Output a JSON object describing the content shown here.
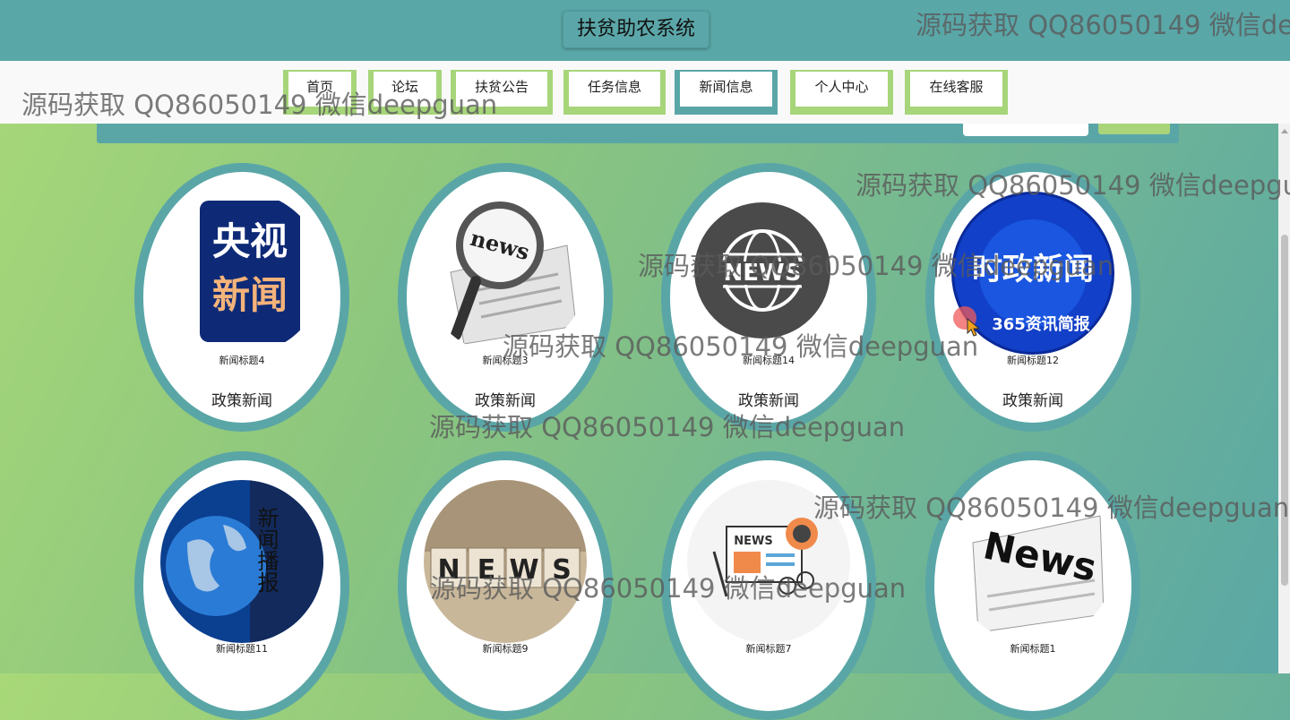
{
  "header": {
    "title": "扶贫助农系统"
  },
  "nav": {
    "items": [
      {
        "label": "首页"
      },
      {
        "label": "论坛"
      },
      {
        "label": "扶贫公告"
      },
      {
        "label": "任务信息"
      },
      {
        "label": "新闻信息"
      },
      {
        "label": "个人中心"
      },
      {
        "label": "在线客服"
      }
    ],
    "active": "新闻信息"
  },
  "news": [
    {
      "title": "新闻标题4",
      "category": "政策新闻",
      "image": "cctv-news-logo"
    },
    {
      "title": "新闻标题3",
      "category": "政策新闻",
      "image": "newspaper-magnifier"
    },
    {
      "title": "新闻标题14",
      "category": "政策新闻",
      "image": "news-globe-icon"
    },
    {
      "title": "新闻标题12",
      "category": "政策新闻",
      "image": "current-affairs-news"
    },
    {
      "title": "新闻标题11",
      "category": "",
      "image": "news-broadcast-globe"
    },
    {
      "title": "新闻标题9",
      "category": "",
      "image": "news-blocks"
    },
    {
      "title": "新闻标题7",
      "category": "",
      "image": "news-flat-illustration"
    },
    {
      "title": "新闻标题1",
      "category": "",
      "image": "newspaper-news"
    }
  ],
  "thumb_text": {
    "cctv_line1": "央视",
    "cctv_line2": "新闻",
    "mag_news": "news",
    "globe_news": "NEWS",
    "shizheng": "时政新闻",
    "shizheng_sub": "365资讯简报",
    "broadcast_vertical": "新闻播报",
    "blocks": [
      "N",
      "E",
      "W",
      "S"
    ],
    "flat_news": "NEWS",
    "paper_news": "News"
  },
  "watermark": "源码获取 QQ86050149 微信deepguan",
  "colors": {
    "teal": "#5aa6a7",
    "green": "#a6d57a"
  }
}
